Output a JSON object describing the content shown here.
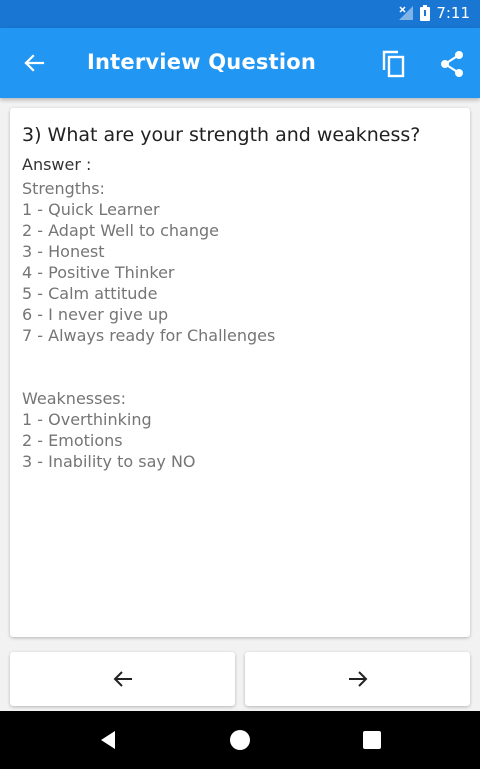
{
  "status_bar": {
    "time": "7:11"
  },
  "app_bar": {
    "title": "Interview Question"
  },
  "content": {
    "question": "3) What are your strength and weakness?",
    "answer_label": "Answer :",
    "answer_text": "Strengths:\n1 - Quick Learner\n2 - Adapt Well to change\n3 - Honest\n4 - Positive Thinker\n5 - Calm attitude\n6 - I never give up\n7 - Always ready for Challenges\n\n\nWeaknesses:\n1 - Overthinking\n2 - Emotions\n3 - Inability to say NO"
  },
  "colors": {
    "app_bar": "#2196f3",
    "status_bar": "#1976d2",
    "answer_text": "#757575"
  },
  "icons": [
    "no-signal-icon",
    "battery-icon",
    "back-arrow-icon",
    "copy-icon",
    "share-icon",
    "arrow-left-icon",
    "arrow-right-icon",
    "nav-back-icon",
    "nav-home-icon",
    "nav-recents-icon"
  ]
}
